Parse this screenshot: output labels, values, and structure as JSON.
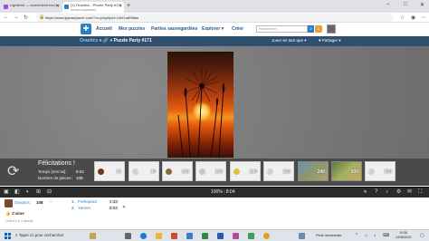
{
  "browser": {
    "tabs": [
      {
        "title": "Lightshot — screenshot tool fo",
        "active": false
      },
      {
        "title": "(1) Oraotics - Puzzle Party #171",
        "subtitle": "MUTER ANLESMEN",
        "active": true
      }
    ],
    "new_tab": "+",
    "window_controls": {
      "minimize": "–",
      "maximize": "□",
      "close": "✕"
    },
    "address": "https://www.jigsawplanet.com/?rc=play&pid=14fe1a89fdbe"
  },
  "site": {
    "nav": [
      "Accueil",
      "Mes puzzles",
      "Parties sauvegardées",
      "Explorer ▾",
      "Créer"
    ],
    "search_placeholder": "Recherche...",
    "notifications": "1"
  },
  "titlebar": {
    "breadcrumb_user": "Oraotics",
    "breadcrumb_sep": " » 🔗 » ",
    "puzzle_title": "Puzzle Party #171",
    "play_as": "Jouer en tant que ▾",
    "share": "♥ Partager ▾"
  },
  "completion": {
    "congrats": "Félicitations !",
    "time_label": "Temps [mm:ss]:",
    "time_value": "8:04",
    "pieces_label": "Nombre de pièces:",
    "pieces_value": "108",
    "piece_options": [
      "35",
      "80",
      "108",
      "108",
      "180",
      "220",
      "240",
      "300",
      "300"
    ]
  },
  "toolbar": {
    "zoom": "100%",
    "separator": "|",
    "timer": "8:04"
  },
  "results": {
    "user": "Oraotics",
    "count": "108",
    "ranking": [
      {
        "rank": "1.",
        "name": "Frehepard",
        "time": "4:33"
      },
      {
        "rank": "2.",
        "name": "Yannm",
        "time": "8:04"
      }
    ],
    "like_label": "J'aime",
    "created": "Créé il y a 4 heures"
  },
  "taskbar": {
    "search": "Taper ici pour rechercher",
    "weather": "Pluie imminente",
    "time": "10:06",
    "date": "14/08/2022"
  },
  "colors": {
    "title_bar": "#2f4f6e",
    "link_blue": "#2c7fc7",
    "panel": "#4a4a4a",
    "puzzle_orange": "#e6620d"
  }
}
